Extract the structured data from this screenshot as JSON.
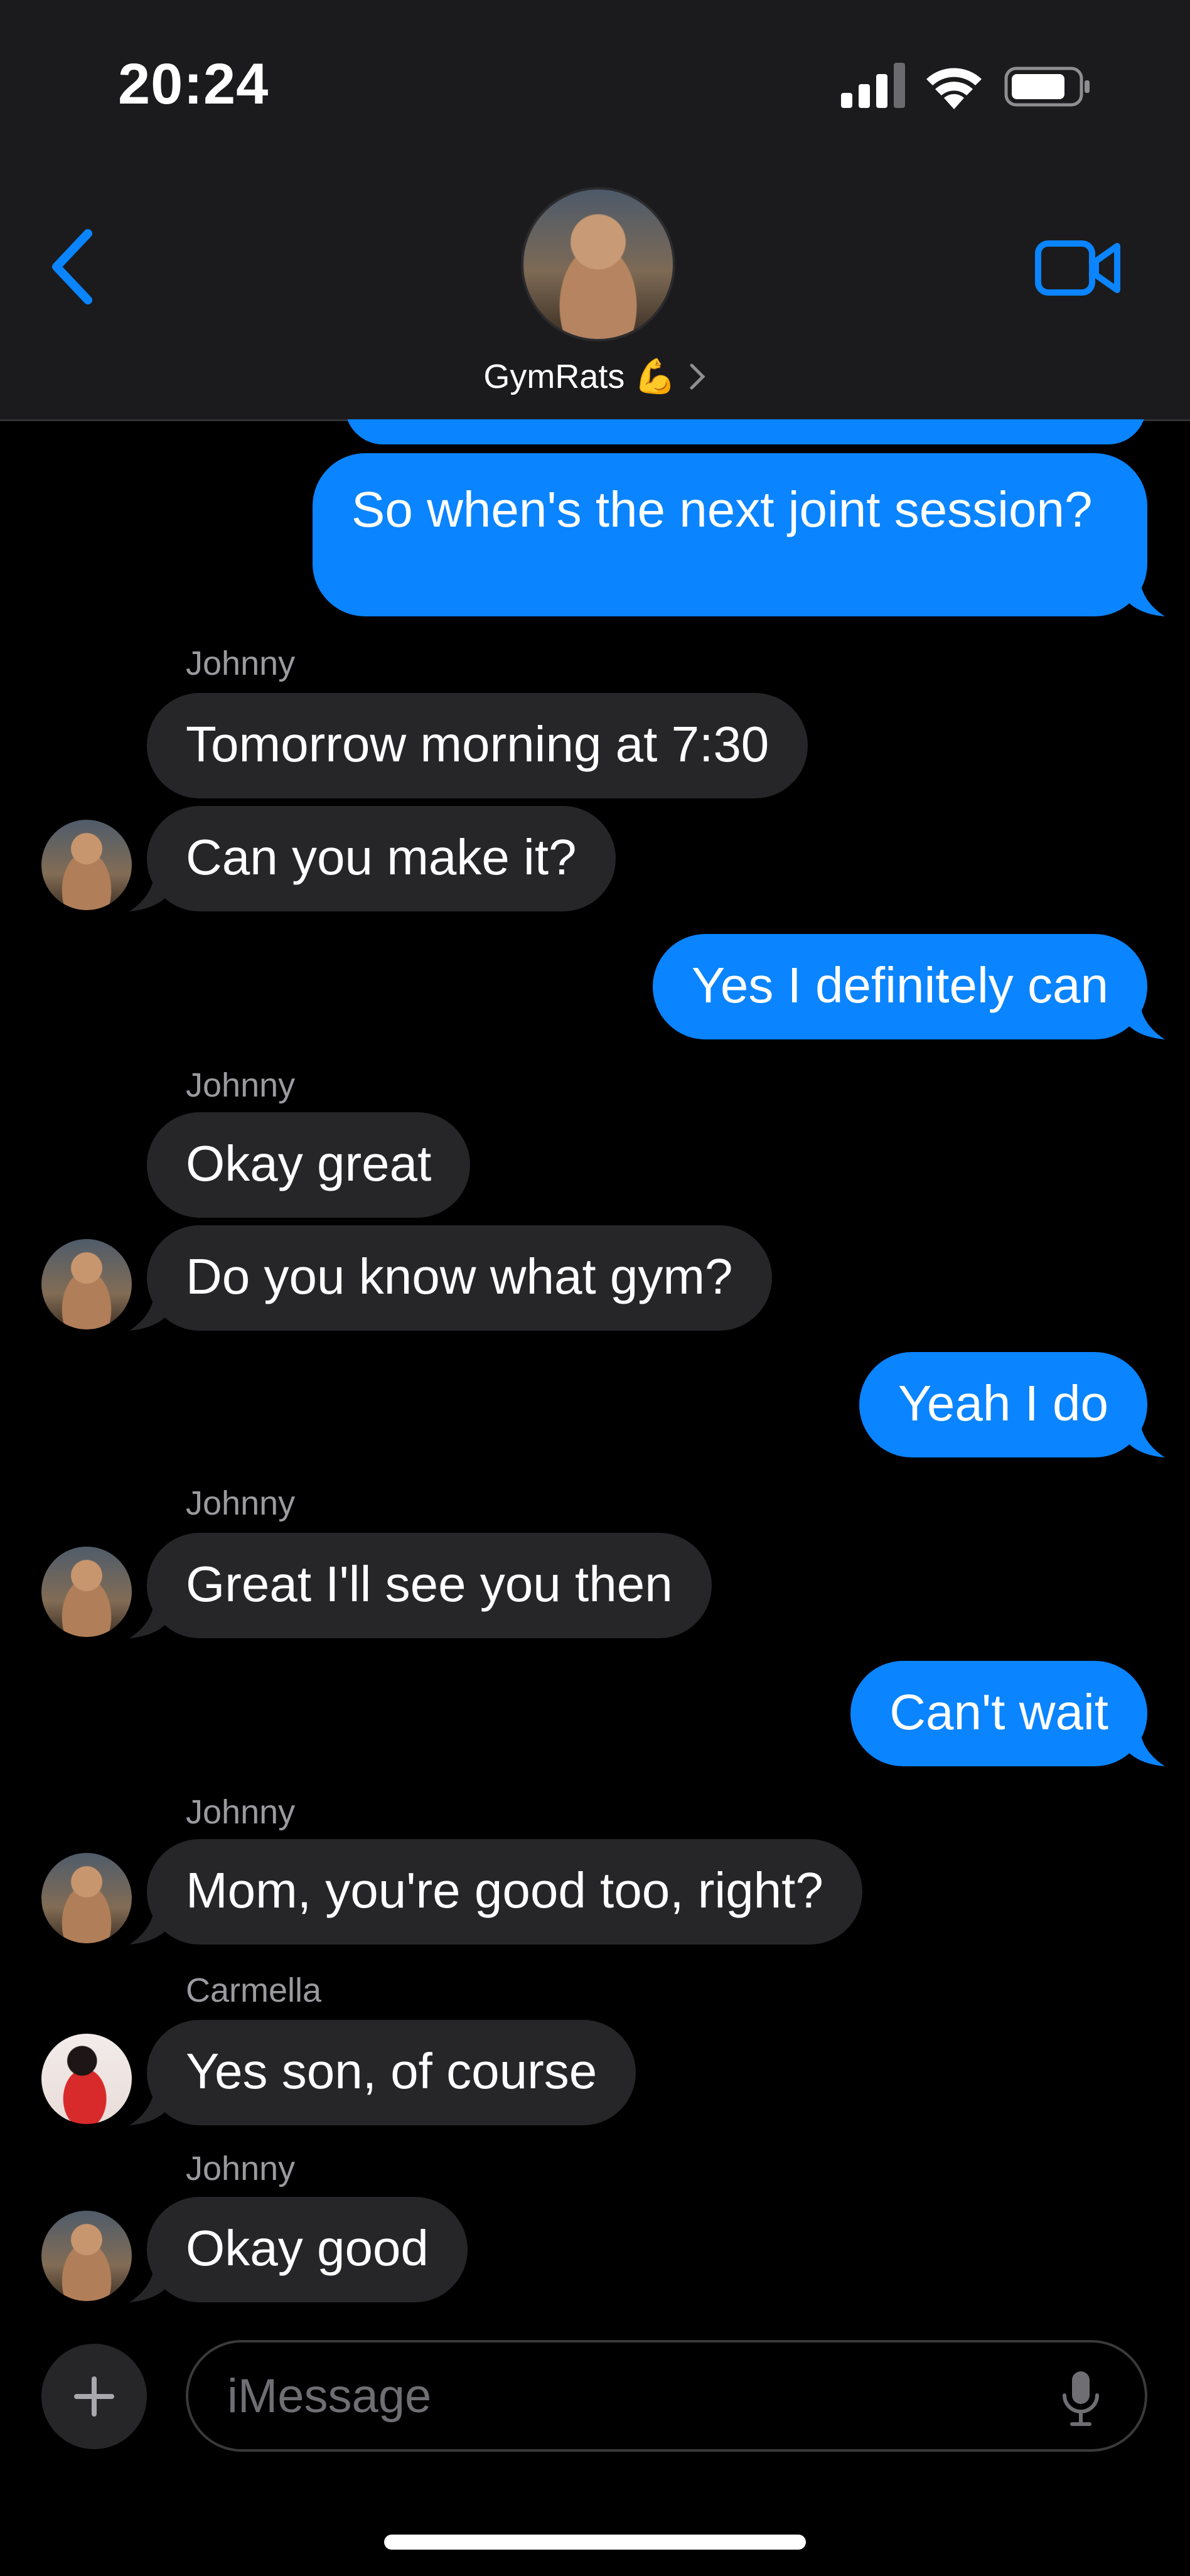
{
  "status_bar": {
    "time": "20:24"
  },
  "header": {
    "group_name": "GymRats 💪"
  },
  "messages": [
    {
      "text": "So when's the next joint session?"
    },
    {
      "sender": "Johnny",
      "text": "Tomorrow morning at 7:30"
    },
    {
      "text": "Can you make it?"
    },
    {
      "text": "Yes I definitely can"
    },
    {
      "sender": "Johnny",
      "text": "Okay great"
    },
    {
      "text": "Do you know what gym?"
    },
    {
      "text": "Yeah I do"
    },
    {
      "sender": "Johnny",
      "text": "Great I'll see you then"
    },
    {
      "text": "Can't wait"
    },
    {
      "sender": "Johnny",
      "text": "Mom, you're good too, right?"
    },
    {
      "sender": "Carmella",
      "text": "Yes son, of course"
    },
    {
      "sender": "Johnny",
      "text": "Okay good"
    }
  ],
  "input": {
    "placeholder": "iMessage"
  },
  "colors": {
    "outgoing": "#0a84ff",
    "incoming": "#262628",
    "accent": "#0a84ff"
  },
  "icons": [
    "back-chevron-icon",
    "video-camera-icon",
    "plus-icon",
    "microphone-icon",
    "signal-icon",
    "wifi-icon",
    "battery-icon"
  ]
}
